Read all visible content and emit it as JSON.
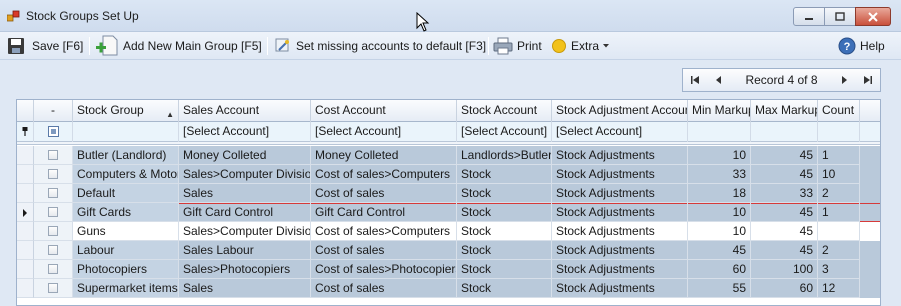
{
  "window": {
    "title": "Stock Groups Set Up"
  },
  "toolbar": {
    "save_label": "Save [F6]",
    "new_group_label": "Add New Main Group [F5]",
    "missing_accounts_label": "Set missing accounts to default [F3]",
    "print_label": "Print",
    "extra_label": "Extra",
    "help_label": "Help"
  },
  "navigator": {
    "record_text": "Record 4 of 8"
  },
  "grid": {
    "columns": [
      "-",
      "Stock Group",
      "Sales Account",
      "Cost Account",
      "Stock Account",
      "Stock Adjustment Account",
      "Min Markup",
      "Max Markup",
      "Count"
    ],
    "filter": {
      "sales_account": "[Select Account]",
      "cost_account": "[Select Account]",
      "stock_account": "[Select Account]",
      "stock_adjustment_account": "[Select Account]"
    },
    "current_row_index": 3,
    "rows": [
      {
        "group": "Butler (Landlord)",
        "sales": "Money Colleted",
        "cost": "Money Colleted",
        "stock": "Landlords>Butler",
        "adjust": "Stock Adjustments",
        "min": "10",
        "max": "45",
        "count": "1"
      },
      {
        "group": "Computers & Motor",
        "sales": "Sales>Computer Division",
        "cost": "Cost of sales>Computers",
        "stock": "Stock",
        "adjust": "Stock Adjustments",
        "min": "33",
        "max": "45",
        "count": "10"
      },
      {
        "group": "Default",
        "sales": "Sales",
        "cost": "Cost of sales",
        "stock": "Stock",
        "adjust": "Stock Adjustments",
        "min": "18",
        "max": "33",
        "count": "2"
      },
      {
        "group": "Gift Cards",
        "sales": "Gift Card Control",
        "cost": "Gift Card Control",
        "stock": "Stock",
        "adjust": "Stock Adjustments",
        "min": "10",
        "max": "45",
        "count": "1"
      },
      {
        "group": "Guns",
        "sales": "Sales>Computer Division",
        "cost": "Cost of sales>Computers",
        "stock": "Stock",
        "adjust": "Stock Adjustments",
        "min": "10",
        "max": "45",
        "count": ""
      },
      {
        "group": "Labour",
        "sales": "Sales Labour",
        "cost": "Cost of sales",
        "stock": "Stock",
        "adjust": "Stock Adjustments",
        "min": "45",
        "max": "45",
        "count": "2"
      },
      {
        "group": "Photocopiers",
        "sales": "Sales>Photocopiers",
        "cost": "Cost of sales>Photocopiers",
        "stock": "Stock",
        "adjust": "Stock Adjustments",
        "min": "60",
        "max": "100",
        "count": "3"
      },
      {
        "group": "Supermarket items",
        "sales": "Sales",
        "cost": "Cost of sales",
        "stock": "Stock",
        "adjust": "Stock Adjustments",
        "min": "55",
        "max": "60",
        "count": "12"
      }
    ]
  },
  "colors": {
    "row_shaded": "#b9c9da",
    "row_white": "#ffffff",
    "current_row_outline": "#d63a3a",
    "filter_row": "#eaf4fb"
  }
}
